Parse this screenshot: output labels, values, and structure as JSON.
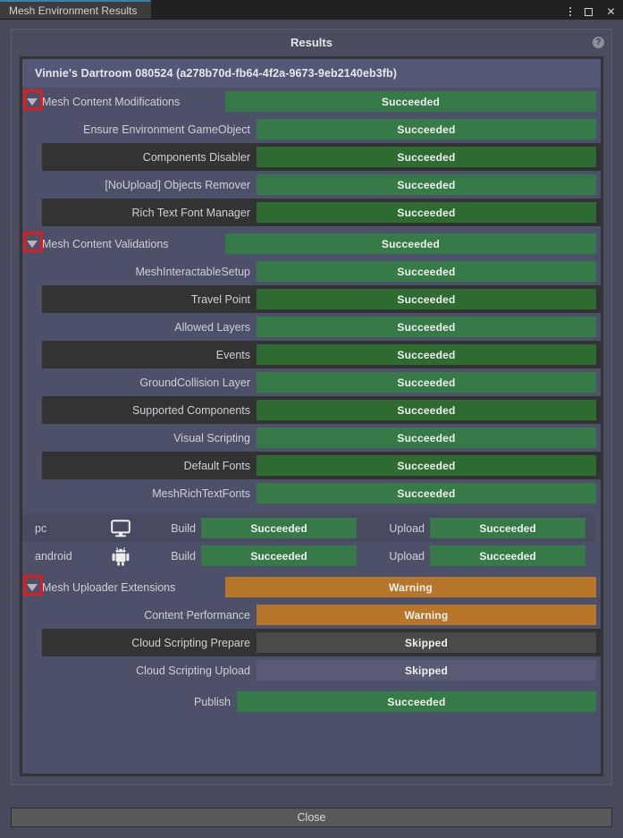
{
  "window": {
    "tab_label": "Mesh Environment Results",
    "menu_icon": "kebab-menu-icon",
    "maximize_icon": "maximize-icon",
    "close_icon": "close-icon"
  },
  "panel": {
    "title": "Results",
    "help_icon": "help-icon",
    "environment_title": "Vinnie's Dartroom 080524 (a278b70d-fb64-4f2a-9673-9eb2140eb3fb)"
  },
  "colors": {
    "succeeded": "#367a47",
    "succeeded_dark": "#2d6b30",
    "warning": "#b7762a",
    "skipped_dark": "#4a4a4a",
    "skipped_light": "#585b73",
    "highlight": "#e41b1b",
    "tab_accent": "#3c7fb1"
  },
  "sections": [
    {
      "name": "Mesh Content Modifications",
      "status": "Succeeded",
      "status_kind": "succeeded-light",
      "highlighted": true,
      "items": [
        {
          "label": "Ensure Environment GameObject",
          "status": "Succeeded",
          "status_kind": "succeeded-light",
          "stripe": "a"
        },
        {
          "label": "Components Disabler",
          "status": "Succeeded",
          "status_kind": "succeeded-dark",
          "stripe": "b"
        },
        {
          "label": "[NoUpload] Objects Remover",
          "status": "Succeeded",
          "status_kind": "succeeded-light",
          "stripe": "a"
        },
        {
          "label": "Rich Text Font Manager",
          "status": "Succeeded",
          "status_kind": "succeeded-dark",
          "stripe": "b"
        }
      ]
    },
    {
      "name": "Mesh Content Validations",
      "status": "Succeeded",
      "status_kind": "succeeded-light",
      "highlighted": true,
      "items": [
        {
          "label": "MeshInteractableSetup",
          "status": "Succeeded",
          "status_kind": "succeeded-light",
          "stripe": "a"
        },
        {
          "label": "Travel Point",
          "status": "Succeeded",
          "status_kind": "succeeded-dark",
          "stripe": "b"
        },
        {
          "label": "Allowed Layers",
          "status": "Succeeded",
          "status_kind": "succeeded-light",
          "stripe": "a"
        },
        {
          "label": "Events",
          "status": "Succeeded",
          "status_kind": "succeeded-dark",
          "stripe": "b"
        },
        {
          "label": "GroundCollision Layer",
          "status": "Succeeded",
          "status_kind": "succeeded-light",
          "stripe": "a"
        },
        {
          "label": "Supported Components",
          "status": "Succeeded",
          "status_kind": "succeeded-dark",
          "stripe": "b"
        },
        {
          "label": "Visual Scripting",
          "status": "Succeeded",
          "status_kind": "succeeded-light",
          "stripe": "a"
        },
        {
          "label": "Default Fonts",
          "status": "Succeeded",
          "status_kind": "succeeded-dark",
          "stripe": "b"
        },
        {
          "label": "MeshRichTextFonts",
          "status": "Succeeded",
          "status_kind": "succeeded-light",
          "stripe": "a"
        }
      ]
    }
  ],
  "platforms": [
    {
      "name": "pc",
      "icon": "desktop-monitor-icon",
      "build_label": "Build",
      "build_status": "Succeeded",
      "upload_label": "Upload",
      "upload_status": "Succeeded"
    },
    {
      "name": "android",
      "icon": "android-robot-icon",
      "build_label": "Build",
      "build_status": "Succeeded",
      "upload_label": "Upload",
      "upload_status": "Succeeded"
    }
  ],
  "uploader_extensions": {
    "name": "Mesh Uploader Extensions",
    "status": "Warning",
    "status_kind": "warning",
    "highlighted": true,
    "items": [
      {
        "label": "Content Performance",
        "status": "Warning",
        "status_kind": "warning",
        "stripe": "a"
      },
      {
        "label": "Cloud Scripting Prepare",
        "status": "Skipped",
        "status_kind": "skipped-dark",
        "stripe": "b"
      },
      {
        "label": "Cloud Scripting Upload",
        "status": "Skipped",
        "status_kind": "skipped-light",
        "stripe": "a"
      }
    ]
  },
  "publish": {
    "label": "Publish",
    "status": "Succeeded",
    "status_kind": "succeeded-light"
  },
  "footer": {
    "close_label": "Close"
  }
}
